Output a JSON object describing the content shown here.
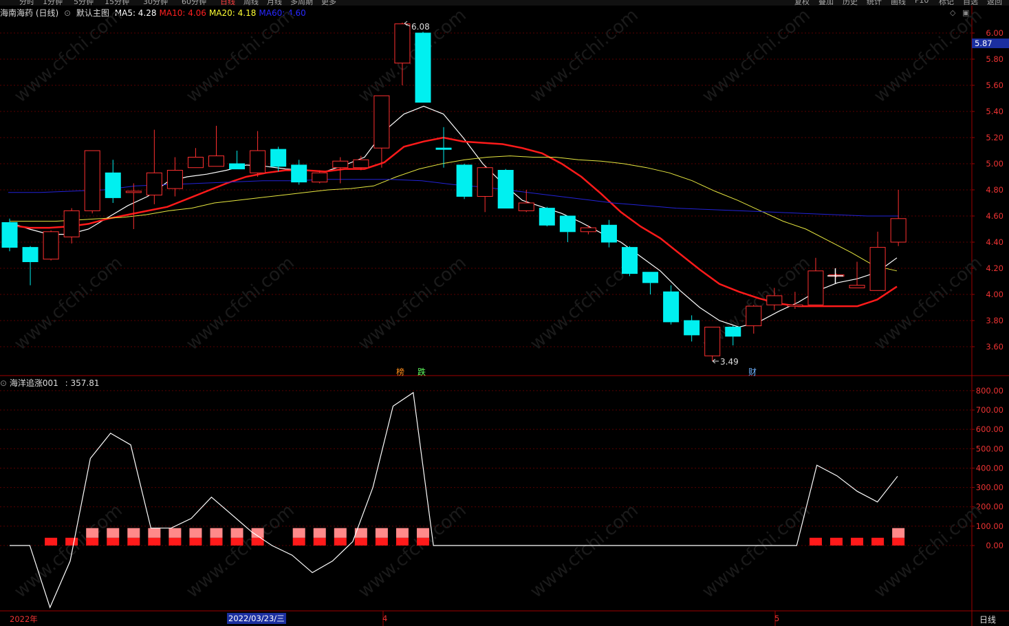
{
  "toolbar": {
    "left": [
      "分时",
      "1分钟",
      "5分钟",
      "15分钟",
      "30分钟",
      "60分钟",
      "日线",
      "周线",
      "月线",
      "多周期",
      "更多"
    ],
    "active": "日线",
    "right": [
      "复权",
      "叠加",
      "历史",
      "统计",
      "画线",
      "F10",
      "标记",
      "自选",
      "返回"
    ]
  },
  "main": {
    "stock": "海南海药 (日线)",
    "template": "默认主图",
    "ma": [
      {
        "label": "MA5:",
        "value": "4.28",
        "color": "#ffffff"
      },
      {
        "label": "MA10:",
        "value": "4.06",
        "color": "#ff2020"
      },
      {
        "label": "MA20:",
        "value": "4.18",
        "color": "#ffff33"
      },
      {
        "label": "MA60:",
        "value": "4.60",
        "color": "#2828ff"
      }
    ],
    "price_label": "5.87",
    "high_label": "6.08",
    "low_label": "3.49",
    "markers": [
      "榜",
      "跌",
      "财"
    ]
  },
  "sub": {
    "name": "海洋追涨001",
    "value": ": 357.81"
  },
  "dates": {
    "year": "2022年",
    "cursor": "2022/03/23/三",
    "m4": "4",
    "m5": "5",
    "period": "日线"
  },
  "watermark": "www.cfchi.com",
  "chart_data": [
    {
      "type": "candlestick",
      "title": "海南海药 (日线)",
      "ylim": [
        3.4,
        6.1
      ],
      "yticks": [
        "6.00",
        "5.80",
        "5.60",
        "5.40",
        "5.20",
        "5.00",
        "4.80",
        "4.60",
        "4.40",
        "4.20",
        "4.00",
        "3.80",
        "3.60"
      ],
      "candles": [
        {
          "o": 4.55,
          "c": 4.36,
          "h": 4.58,
          "l": 4.33
        },
        {
          "o": 4.36,
          "c": 4.25,
          "h": 4.37,
          "l": 4.07
        },
        {
          "o": 4.27,
          "c": 4.48,
          "h": 4.49,
          "l": 4.26
        },
        {
          "o": 4.44,
          "c": 4.64,
          "h": 4.66,
          "l": 4.39
        },
        {
          "o": 4.64,
          "c": 5.1,
          "h": 5.1,
          "l": 4.62
        },
        {
          "o": 4.93,
          "c": 4.74,
          "h": 5.03,
          "l": 4.7
        },
        {
          "o": 4.78,
          "c": 4.79,
          "h": 4.85,
          "l": 4.5
        },
        {
          "o": 4.76,
          "c": 4.93,
          "h": 5.26,
          "l": 4.69
        },
        {
          "o": 4.81,
          "c": 4.95,
          "h": 5.05,
          "l": 4.75
        },
        {
          "o": 4.97,
          "c": 5.05,
          "h": 5.12,
          "l": 4.97
        },
        {
          "o": 4.98,
          "c": 5.06,
          "h": 5.29,
          "l": 4.98
        },
        {
          "o": 5.0,
          "c": 4.96,
          "h": 5.1,
          "l": 4.96
        },
        {
          "o": 4.93,
          "c": 5.1,
          "h": 5.25,
          "l": 4.9
        },
        {
          "o": 5.11,
          "c": 4.98,
          "h": 5.13,
          "l": 4.94
        },
        {
          "o": 4.99,
          "c": 4.86,
          "h": 5.03,
          "l": 4.84
        },
        {
          "o": 4.86,
          "c": 4.93,
          "h": 4.95,
          "l": 4.85
        },
        {
          "o": 4.97,
          "c": 5.02,
          "h": 5.05,
          "l": 4.85
        },
        {
          "o": 4.97,
          "c": 5.03,
          "h": 5.06,
          "l": 4.95
        },
        {
          "o": 5.12,
          "c": 5.52,
          "h": 5.52,
          "l": 4.97
        },
        {
          "o": 5.77,
          "c": 6.07,
          "h": 6.08,
          "l": 5.6
        },
        {
          "o": 6.0,
          "c": 5.47,
          "h": 6.01,
          "l": 5.47
        },
        {
          "o": 5.12,
          "c": 5.11,
          "h": 5.28,
          "l": 4.97
        },
        {
          "o": 4.99,
          "c": 4.75,
          "h": 5.0,
          "l": 4.73
        },
        {
          "o": 4.75,
          "c": 4.97,
          "h": 4.98,
          "l": 4.63
        },
        {
          "o": 4.95,
          "c": 4.66,
          "h": 4.96,
          "l": 4.66
        },
        {
          "o": 4.64,
          "c": 4.7,
          "h": 4.8,
          "l": 4.63
        },
        {
          "o": 4.66,
          "c": 4.53,
          "h": 4.67,
          "l": 4.52
        },
        {
          "o": 4.6,
          "c": 4.48,
          "h": 4.6,
          "l": 4.4
        },
        {
          "o": 4.48,
          "c": 4.51,
          "h": 4.53,
          "l": 4.46
        },
        {
          "o": 4.53,
          "c": 4.4,
          "h": 4.57,
          "l": 4.36
        },
        {
          "o": 4.36,
          "c": 4.16,
          "h": 4.37,
          "l": 4.14
        },
        {
          "o": 4.17,
          "c": 4.09,
          "h": 4.17,
          "l": 4.0
        },
        {
          "o": 4.02,
          "c": 3.79,
          "h": 4.07,
          "l": 3.77
        },
        {
          "o": 3.8,
          "c": 3.69,
          "h": 3.84,
          "l": 3.64
        },
        {
          "o": 3.53,
          "c": 3.75,
          "h": 3.75,
          "l": 3.49
        },
        {
          "o": 3.75,
          "c": 3.68,
          "h": 3.76,
          "l": 3.61
        },
        {
          "o": 3.76,
          "c": 3.91,
          "h": 3.92,
          "l": 3.7
        },
        {
          "o": 3.92,
          "c": 3.99,
          "h": 4.05,
          "l": 3.88
        },
        {
          "o": 3.91,
          "c": 3.92,
          "h": 4.02,
          "l": 3.89
        },
        {
          "o": 3.92,
          "c": 4.18,
          "h": 4.28,
          "l": 3.92
        },
        {
          "o": 4.15,
          "c": 4.15,
          "h": 4.16,
          "l": 4.13
        },
        {
          "o": 4.05,
          "c": 4.07,
          "h": 4.25,
          "l": 4.05
        },
        {
          "o": 4.03,
          "c": 4.36,
          "h": 4.48,
          "l": 4.03
        },
        {
          "o": 4.4,
          "c": 4.58,
          "h": 4.8,
          "l": 4.37
        }
      ],
      "series": [
        {
          "name": "MA5",
          "values": [
            4.55,
            4.5,
            4.46,
            4.46,
            4.5,
            4.59,
            4.68,
            4.75,
            4.86,
            4.9,
            4.92,
            4.95,
            4.99,
            4.98,
            4.96,
            4.95,
            4.94,
            4.99,
            5.05,
            5.25,
            5.38,
            5.44,
            5.38,
            5.2,
            5.0,
            4.85,
            4.72,
            4.67,
            4.62,
            4.55,
            4.47,
            4.4,
            4.29,
            4.18,
            4.03,
            3.9,
            3.8,
            3.75,
            3.79,
            3.87,
            3.94,
            4.03,
            4.09,
            4.12,
            4.17,
            4.28
          ]
        },
        {
          "name": "MA10",
          "values": [
            4.53,
            4.51,
            4.51,
            4.52,
            4.54,
            4.58,
            4.61,
            4.64,
            4.67,
            4.73,
            4.79,
            4.85,
            4.9,
            4.93,
            4.95,
            4.95,
            4.94,
            4.96,
            4.96,
            5.01,
            5.13,
            5.17,
            5.2,
            5.17,
            5.16,
            5.15,
            5.12,
            5.08,
            5.0,
            4.9,
            4.77,
            4.63,
            4.52,
            4.43,
            4.31,
            4.19,
            4.08,
            4.02,
            3.97,
            3.93,
            3.91,
            3.91,
            3.91,
            3.91,
            3.96,
            4.06
          ]
        },
        {
          "name": "MA20",
          "values": [
            4.56,
            4.56,
            4.56,
            4.57,
            4.58,
            4.59,
            4.61,
            4.64,
            4.66,
            4.7,
            4.72,
            4.74,
            4.76,
            4.78,
            4.8,
            4.81,
            4.83,
            4.9,
            4.96,
            5.0,
            5.03,
            5.05,
            5.06,
            5.05,
            5.05,
            5.03,
            5.02,
            5.0,
            4.97,
            4.93,
            4.87,
            4.79,
            4.72,
            4.64,
            4.56,
            4.5,
            4.41,
            4.32,
            4.22,
            4.18
          ]
        },
        {
          "name": "MA60",
          "values": [
            4.78,
            4.78,
            4.79,
            4.8,
            4.83,
            4.84,
            4.85,
            4.86,
            4.87,
            4.87,
            4.88,
            4.88,
            4.88,
            4.87,
            4.84,
            4.82,
            4.79,
            4.76,
            4.73,
            4.7,
            4.68,
            4.66,
            4.65,
            4.64,
            4.63,
            4.62,
            4.61,
            4.6,
            4.6
          ]
        }
      ]
    },
    {
      "type": "line",
      "title": "海洋追涨001",
      "ylim": [
        -350,
        850
      ],
      "yticks": [
        "800.00",
        "700.00",
        "600.00",
        "500.00",
        "400.00",
        "300.00",
        "200.00",
        "100.00",
        "0.00"
      ],
      "series": [
        {
          "name": "海洋追涨001",
          "values": [
            0,
            0,
            -320,
            -80,
            450,
            580,
            520,
            90,
            90,
            140,
            250,
            160,
            70,
            0,
            -50,
            -140,
            -80,
            20,
            300,
            720,
            790,
            0,
            0,
            0,
            0,
            0,
            0,
            0,
            0,
            0,
            0,
            0,
            0,
            0,
            0,
            0,
            0,
            0,
            0,
            0,
            415,
            360,
            280,
            225,
            357.81
          ]
        }
      ],
      "bars": [
        {
          "i": 2,
          "h": 40
        },
        {
          "i": 3,
          "h": 40
        },
        {
          "i": 4,
          "h": 90
        },
        {
          "i": 5,
          "h": 90
        },
        {
          "i": 6,
          "h": 90
        },
        {
          "i": 7,
          "h": 90
        },
        {
          "i": 8,
          "h": 90
        },
        {
          "i": 9,
          "h": 90
        },
        {
          "i": 10,
          "h": 90
        },
        {
          "i": 11,
          "h": 90
        },
        {
          "i": 12,
          "h": 90
        },
        {
          "i": 14,
          "h": 90
        },
        {
          "i": 15,
          "h": 90
        },
        {
          "i": 16,
          "h": 90
        },
        {
          "i": 17,
          "h": 90
        },
        {
          "i": 18,
          "h": 90
        },
        {
          "i": 19,
          "h": 90
        },
        {
          "i": 20,
          "h": 90
        },
        {
          "i": 39,
          "h": 40
        },
        {
          "i": 40,
          "h": 40
        },
        {
          "i": 41,
          "h": 40
        },
        {
          "i": 42,
          "h": 40
        },
        {
          "i": 43,
          "h": 90
        }
      ]
    }
  ]
}
